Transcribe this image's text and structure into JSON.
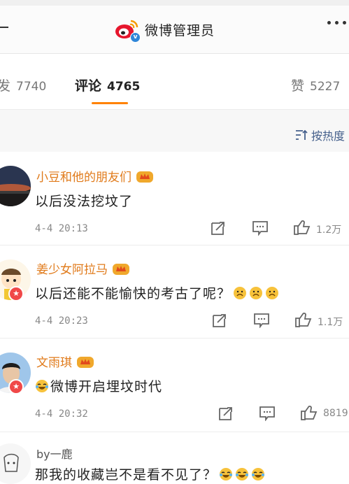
{
  "header": {
    "title": "微博管理员"
  },
  "tabs": [
    {
      "label": "发",
      "count": "7740"
    },
    {
      "label": "评论",
      "count": "4765"
    },
    {
      "label": "赞",
      "count": "5227"
    }
  ],
  "sort": {
    "label": "按热度"
  },
  "comments": [
    {
      "username": "小豆和他的朋友们",
      "text": "以后没法挖坟了",
      "time": "4-4  20:13",
      "likes": "1.2万"
    },
    {
      "username": "姜少女阿拉马",
      "text": "以后还能不能愉快的考古了呢？",
      "time": "4-4  20:23",
      "likes": "1.1万"
    },
    {
      "username": "文雨琪",
      "text": "微博开启埋坟时代",
      "time": "4-4  20:32",
      "likes": "8819"
    },
    {
      "username": "by一鹿",
      "text": "那我的收藏岂不是看不见了？"
    }
  ],
  "colors": {
    "accent": "#ff8200",
    "username": "#e07a1a",
    "link": "#45608c"
  }
}
